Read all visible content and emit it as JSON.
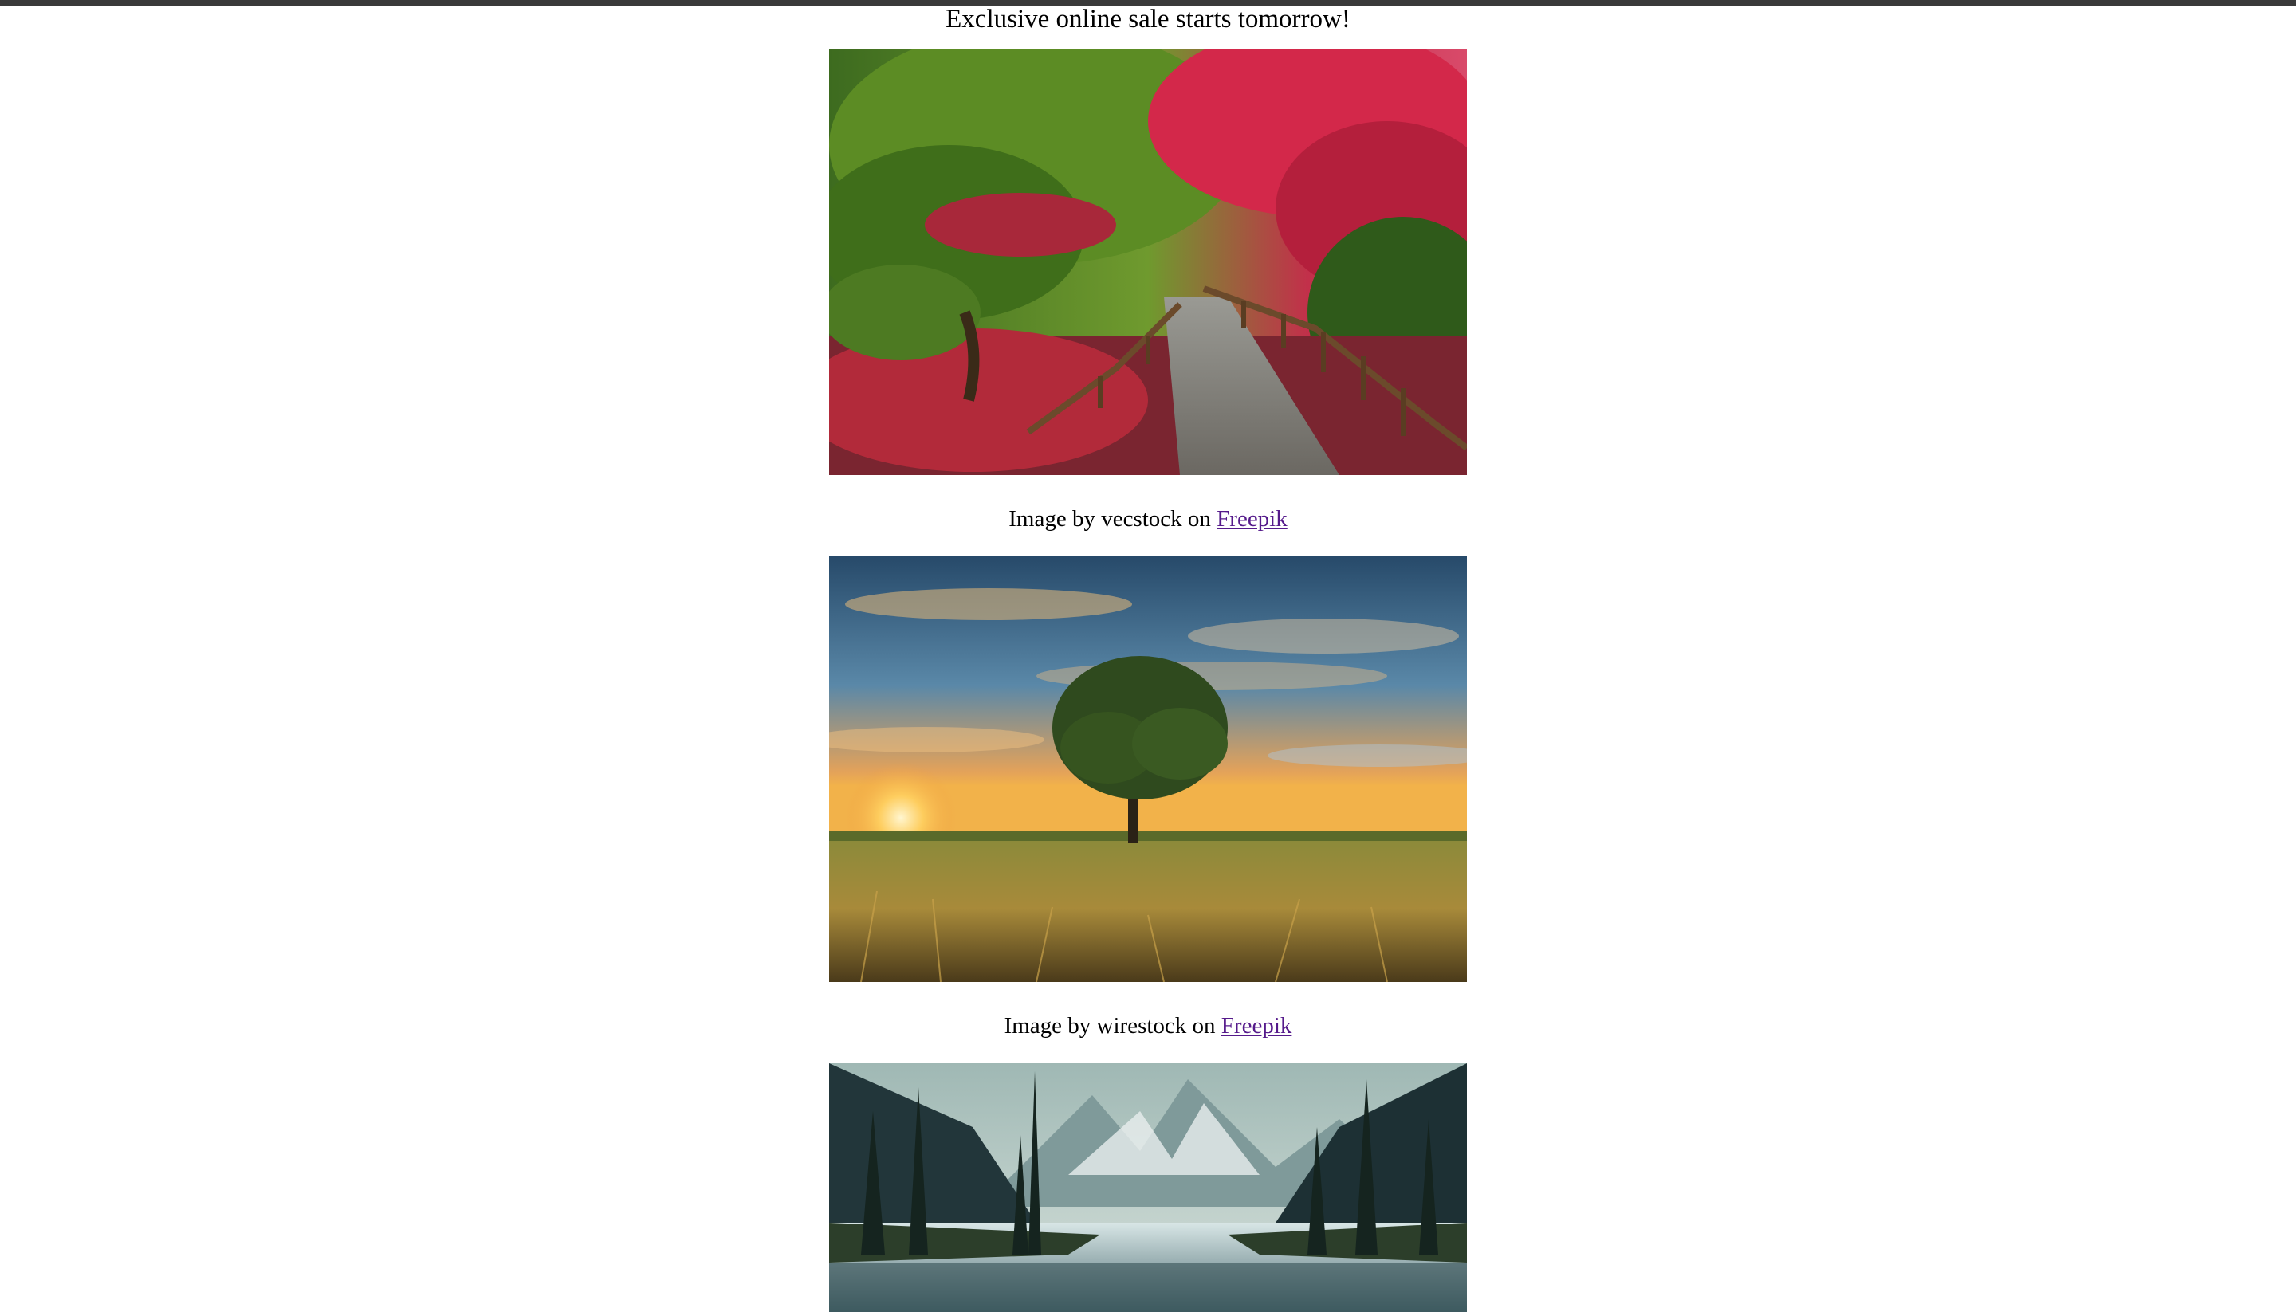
{
  "headline": "Exclusive online sale starts tomorrow!",
  "items": [
    {
      "image_label": "garden-path-photo",
      "caption_prefix": "Image by vecstock on",
      "link_text": "Freepik"
    },
    {
      "image_label": "tree-sunset-photo",
      "caption_prefix": "Image by wirestock on",
      "link_text": "Freepik"
    },
    {
      "image_label": "mountain-lake-photo"
    }
  ],
  "colors": {
    "link_visited": "#551a8b",
    "top_bar": "#3a3a3a"
  }
}
